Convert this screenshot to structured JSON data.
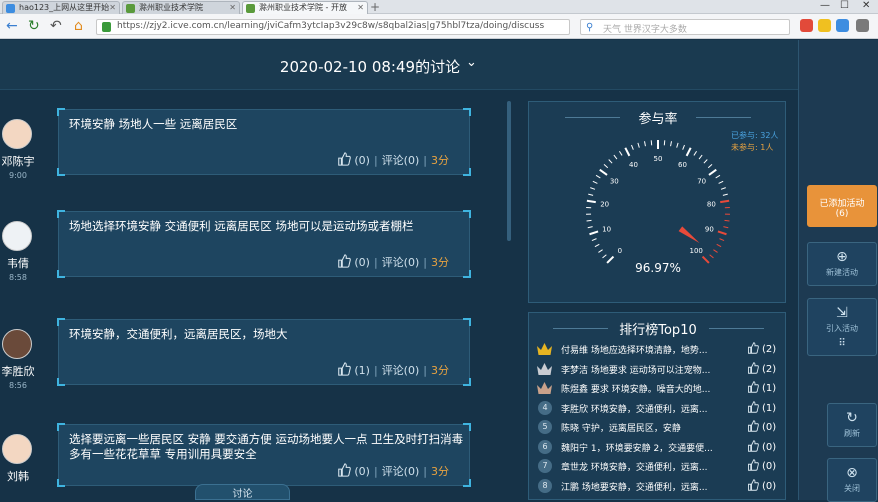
{
  "browser": {
    "tabs": [
      {
        "label": "hao123_上网从这里开始"
      },
      {
        "label": "滁州职业技术学院"
      },
      {
        "label": "滁州职业技术学院 - 开放"
      }
    ],
    "url": "https://zjy2.icve.com.cn/learning/jviCafm3ytcIap3v29c8w/s8qbal2ias|g75hbl7tza/doing/discuss",
    "search_placeholder": "天气 世界汉字大多数"
  },
  "header": {
    "title": "2020-02-10 08:49的讨论"
  },
  "posts": [
    {
      "name": "邓陈宇",
      "time": "9:00",
      "text": "环境安静 场地人一些 远离居民区",
      "likes": "(0)",
      "comments": "评论(0)",
      "score": "3分"
    },
    {
      "name": "韦倩",
      "time": "8:58",
      "text": "场地选择环境安静 交通便利 远离居民区 场地可以是运动场或者棚栏",
      "likes": "(0)",
      "comments": "评论(0)",
      "score": "3分"
    },
    {
      "name": "李胜欣",
      "time": "8:56",
      "text": "环境安静，交通便利，远离居民区，场地大",
      "likes": "(1)",
      "comments": "评论(0)",
      "score": "3分"
    },
    {
      "name": "刘韩",
      "time": "",
      "text": "选择要远离一些居民区 安静 要交通方便 运动场地要人一点 卫生及时打扫消毒 多有一些花花草草 专用训用具要安全",
      "likes": "(0)",
      "comments": "评论(0)",
      "score": "3分"
    }
  ],
  "participation": {
    "title": "参与率",
    "percent_label": "96.97%",
    "value": 96.97,
    "participated": "已参与: 32人",
    "not_participated": "未参与: 1人",
    "ticks": [
      "0",
      "10",
      "20",
      "30",
      "40",
      "50",
      "60",
      "70",
      "80",
      "90",
      "100"
    ]
  },
  "ranking": {
    "title": "排行榜Top10",
    "rows": [
      {
        "rank": "1",
        "text": "付易维 场地应选择环境清静，地势...",
        "likes": "(2)"
      },
      {
        "rank": "2",
        "text": "李梦洁 场地要求 运动场可以注宠物...",
        "likes": "(2)"
      },
      {
        "rank": "3",
        "text": "陈煜鑫 要求 环境安静。噪音大的地...",
        "likes": "(1)"
      },
      {
        "rank": "4",
        "text": "李胜欣 环境安静，交通便利，远离...",
        "likes": "(1)"
      },
      {
        "rank": "5",
        "text": "陈晓 守护，远离居民区，安静",
        "likes": "(0)"
      },
      {
        "rank": "6",
        "text": "魏阳宁 1，环境要安静 2，交通要便...",
        "likes": "(0)"
      },
      {
        "rank": "7",
        "text": "章世龙 环境安静，交通便利，远离...",
        "likes": "(0)"
      },
      {
        "rank": "8",
        "text": "江鹏 场地要安静，交通便利，远离...",
        "likes": "(0)"
      }
    ]
  },
  "side": {
    "added": "已添加活动",
    "added_count": "(6)",
    "new_activity": "新建活动",
    "import_activity": "引入活动",
    "refresh": "刷新",
    "close": "关闭"
  },
  "bottom_tab": "讨论",
  "colors": {
    "accent": "#3fb4e0",
    "score": "#e8a341",
    "added_btn": "#e8933a",
    "gold": "#e6b422"
  }
}
